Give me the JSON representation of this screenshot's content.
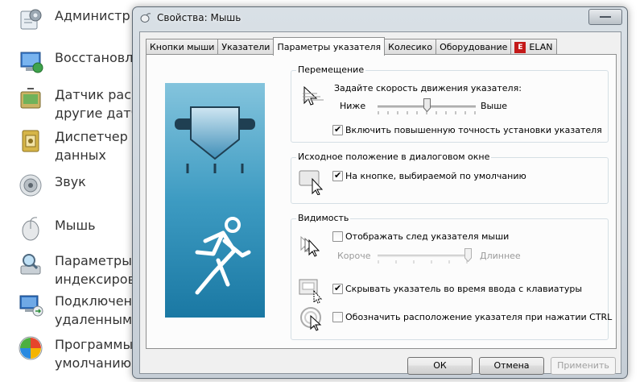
{
  "background_list": [
    {
      "label": "Администр",
      "icon": "admin-tools-icon"
    },
    {
      "label": "Восстановле",
      "icon": "restore-icon"
    },
    {
      "label": "Датчик распо\nдругие датчи",
      "icon": "sensor-icon"
    },
    {
      "label": "Диспетчер ус\nданных",
      "icon": "credential-manager-icon"
    },
    {
      "label": "Звук",
      "icon": "sound-icon"
    },
    {
      "label": "Мышь",
      "icon": "mouse-icon"
    },
    {
      "label": "Параметры\nиндексирова",
      "icon": "indexing-icon"
    },
    {
      "label": "Подключени\nудаленным р",
      "icon": "remote-connection-icon"
    },
    {
      "label": "Программы п\nумолчанию",
      "icon": "default-programs-icon"
    }
  ],
  "dialog": {
    "title": "Свойства: Мышь",
    "tabs": [
      {
        "label": "Кнопки мыши",
        "active": false
      },
      {
        "label": "Указатели",
        "active": false
      },
      {
        "label": "Параметры указателя",
        "active": true
      },
      {
        "label": "Колесико",
        "active": false
      },
      {
        "label": "Оборудование",
        "active": false
      },
      {
        "label": "ELAN",
        "active": false,
        "icon": "elan-logo-icon"
      }
    ],
    "motion": {
      "title": "Перемещение",
      "prompt": "Задайте скорость движения указателя:",
      "slow_label": "Ниже",
      "fast_label": "Выше",
      "speed_level": 0.5,
      "enhance_label": "Включить повышенную точность установки указателя",
      "enhance_checked": true
    },
    "snap": {
      "title": "Исходное положение в диалоговом окне",
      "label": "На кнопке, выбираемой по умолчанию",
      "checked": true
    },
    "visibility": {
      "title": "Видимость",
      "trails_label": "Отображать след указателя мыши",
      "trails_checked": false,
      "short_label": "Короче",
      "long_label": "Длиннее",
      "trails_level": 1.0,
      "hide_label": "Скрывать указатель во время ввода с клавиатуры",
      "hide_checked": true,
      "ctrl_label": "Обозначить расположение указателя при нажатии CTRL",
      "ctrl_checked": false
    },
    "buttons": {
      "ok": "ОК",
      "cancel": "Отмена",
      "apply": "Применить"
    },
    "colors": {
      "illustration_top": "#5fb4cf",
      "illustration_bottom": "#1c7fa8"
    }
  }
}
